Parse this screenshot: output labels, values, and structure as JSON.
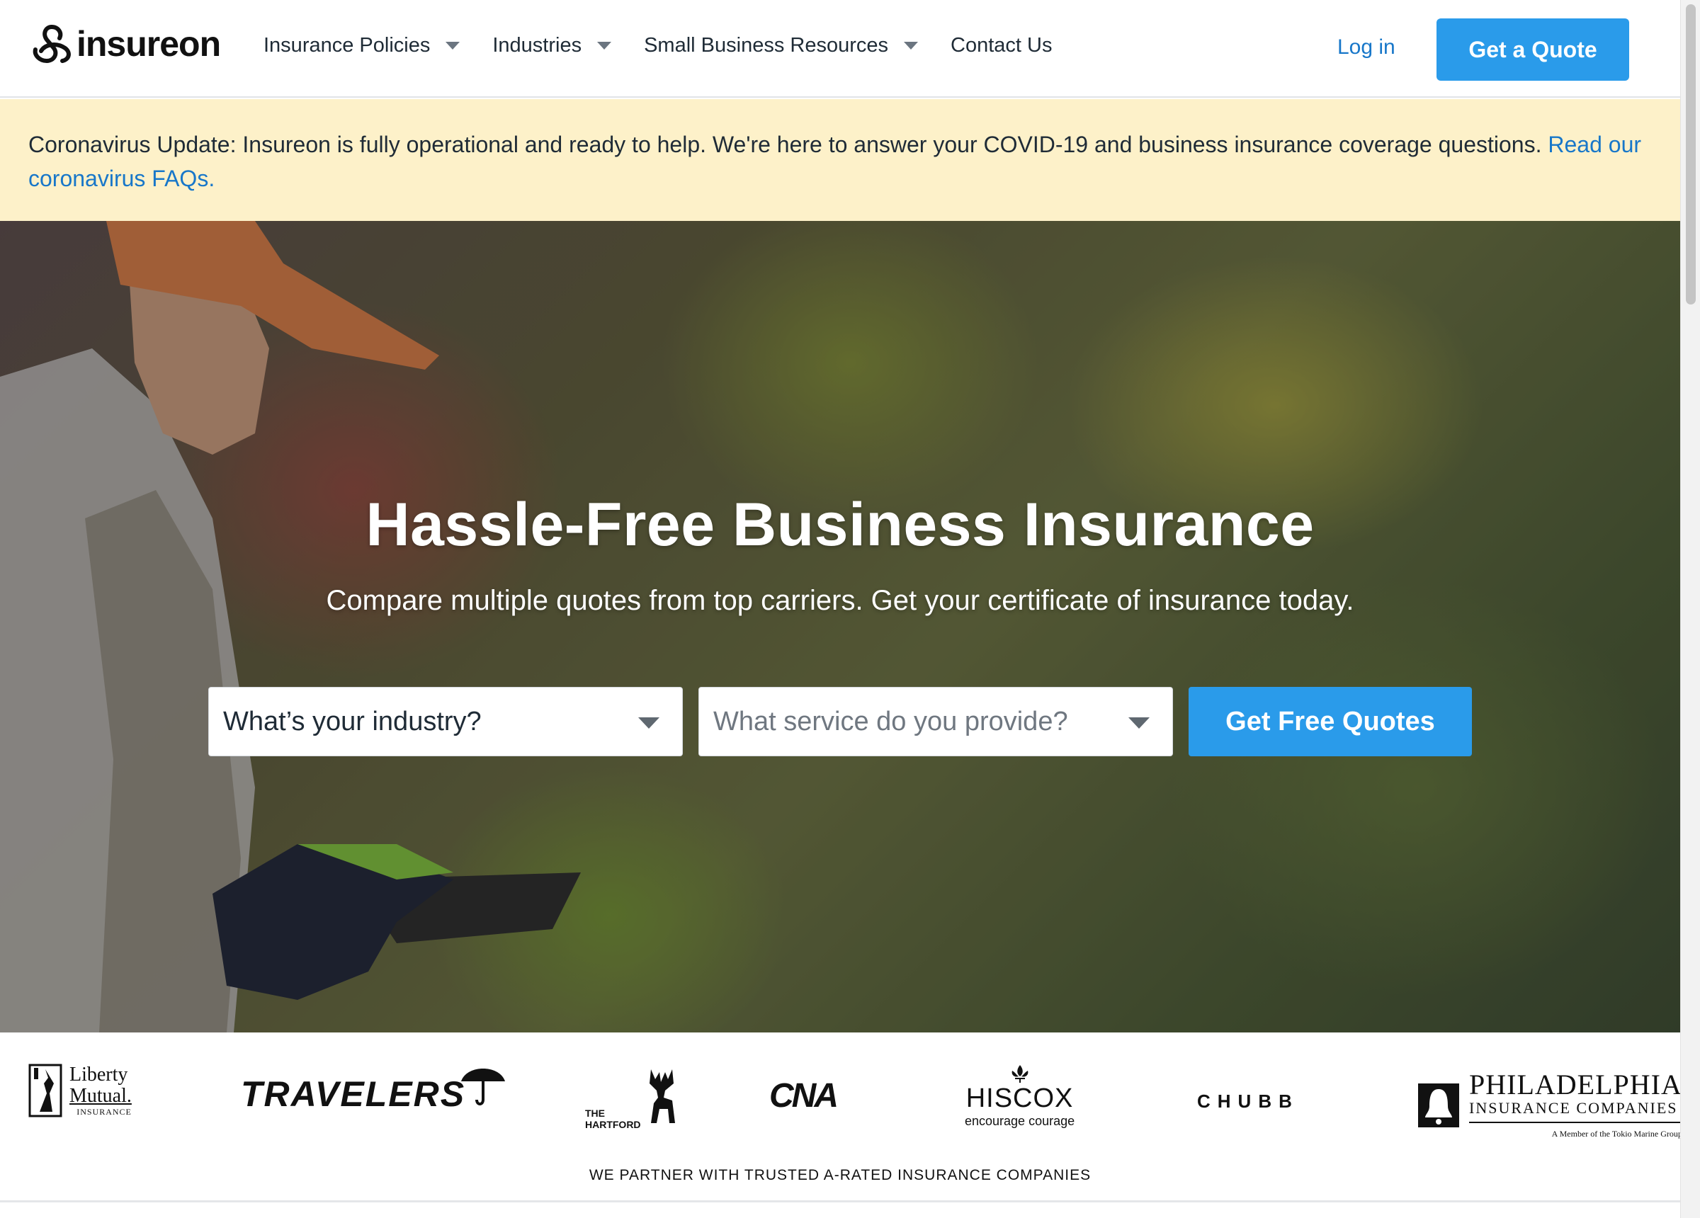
{
  "header": {
    "logo_text": "insureon",
    "nav": [
      {
        "label": "Insurance Policies",
        "has_dropdown": true
      },
      {
        "label": "Industries",
        "has_dropdown": true
      },
      {
        "label": "Small Business Resources",
        "has_dropdown": true
      },
      {
        "label": "Contact Us",
        "has_dropdown": false
      }
    ],
    "login_label": "Log in",
    "quote_button": "Get a Quote"
  },
  "alert": {
    "text": "Coronavirus Update: Insureon is fully operational and ready to help. We're here to answer your COVID-19 and business insurance coverage questions.",
    "link_text": "Read our coronavirus FAQs."
  },
  "hero": {
    "title": "Hassle-Free Business Insurance",
    "subtitle": "Compare multiple quotes from top carriers. Get your certificate of insurance today.",
    "industry_select": "What’s your industry?",
    "service_select": "What service do you provide?",
    "cta_button": "Get Free Quotes"
  },
  "partners": {
    "logos": {
      "liberty_mutual": {
        "line1": "Liberty",
        "line2": "Mutual.",
        "line3": "INSURANCE"
      },
      "travelers": "TRAVELERS",
      "hartford": {
        "line1": "THE",
        "line2": "HARTFORD"
      },
      "cna": "CNA",
      "hiscox": {
        "name": "HISCOX",
        "tagline": "encourage courage"
      },
      "chubb": "CHUBB",
      "philadelphia": {
        "line1": "PHILADELPHIA",
        "line2": "INSURANCE COMPANIES",
        "line3": "A Member of the Tokio Marine Group"
      }
    },
    "caption": "WE PARTNER WITH TRUSTED A-RATED INSURANCE COMPANIES"
  },
  "colors": {
    "brand_blue": "#2a9bea",
    "link_blue": "#1877c9",
    "alert_bg": "#fdf1c9"
  }
}
